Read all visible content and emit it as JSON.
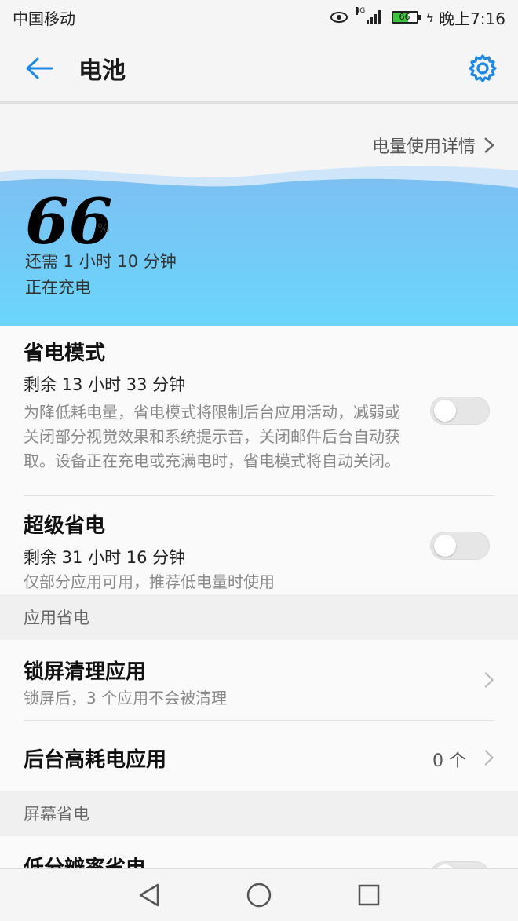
{
  "status_bar": {
    "carrier": "中国移动",
    "network": "4G",
    "battery": "66",
    "time": "晚上7:16"
  },
  "app_bar": {
    "title": "电池"
  },
  "hero": {
    "detail_link": "电量使用详情",
    "percent": "66",
    "percent_sign": "%",
    "remaining": "还需 1 小时 10 分钟",
    "status": "正在充电",
    "level_fraction": 0.66
  },
  "power_saving": {
    "title": "省电模式",
    "remaining": "剩余 13 小时 33 分钟",
    "description": "为降低耗电量，省电模式将限制后台应用活动，减弱或关闭部分视觉效果和系统提示音，关闭邮件后台自动获取。设备正在充电或充满电时，省电模式将自动关闭。",
    "enabled": false
  },
  "ultra_saving": {
    "title": "超级省电",
    "remaining": "剩余 31 小时 16 分钟",
    "description": "仅部分应用可用，推荐低电量时使用",
    "enabled": false
  },
  "app_section": {
    "header": "应用省电",
    "lock_clean": {
      "title": "锁屏清理应用",
      "subtitle": "锁屏后，3 个应用不会被清理"
    },
    "bg_high": {
      "title": "后台高耗电应用",
      "count": "0 个"
    }
  },
  "screen_section": {
    "header": "屏幕省电",
    "low_res": {
      "title": "低分辨率省电"
    }
  },
  "colors": {
    "accent": "#1e88e5",
    "wave_top": "#7cc0f2",
    "wave_bottom": "#6ad6fb"
  },
  "icons": {
    "back": "arrow-left-icon",
    "settings": "gear-icon",
    "nav_back": "triangle-back-icon",
    "nav_home": "circle-home-icon",
    "nav_recent": "square-recent-icon"
  }
}
